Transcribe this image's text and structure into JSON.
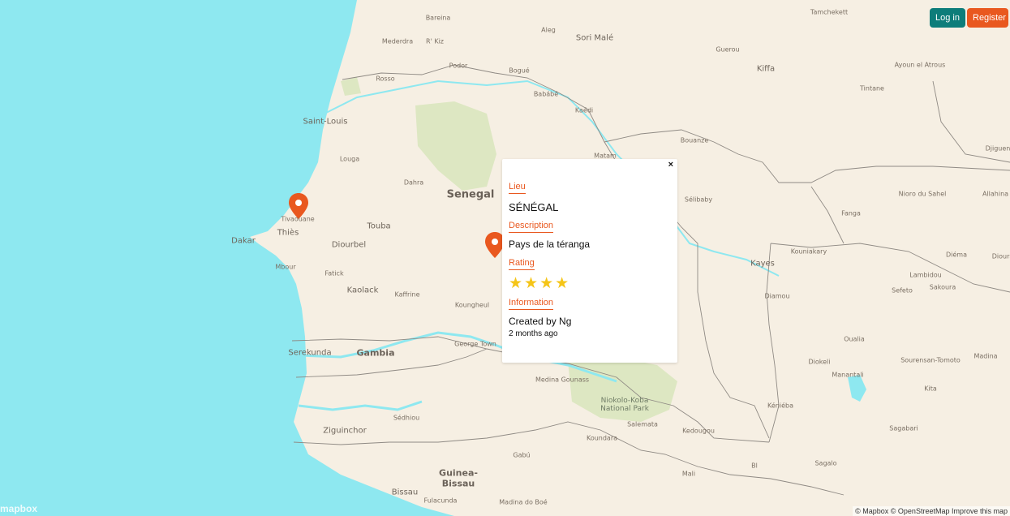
{
  "auth": {
    "login_label": "Log in",
    "register_label": "Register"
  },
  "map": {
    "country_label": "Senegal",
    "gambia_label": "Gambia",
    "guinea_bissau_label": "Guinea-\nBissau",
    "park_label": "Niokolo-Koba\nNational Park",
    "places": [
      "Bareina",
      "Aleg",
      "Sori Malé",
      "Tamchekett",
      "Mederdra",
      "R' Kiz",
      "Guerou",
      "Kiffa",
      "Ayoun el Atrous",
      "Podor",
      "Bogué",
      "Rosso",
      "Babábé",
      "Tintane",
      "Kaédi",
      "Saint-Louis",
      "Bouanze",
      "Djiguen",
      "Louga",
      "Matam",
      "Dahra",
      "Sélibaby",
      "Niorо du Sahel",
      "Allahina",
      "Tivaouane",
      "Fanga",
      "Thiès",
      "Touba",
      "Dakar",
      "Diourbel",
      "Kouniakary",
      "Diéma",
      "Dioura",
      "Mbour",
      "Fatick",
      "Kayes",
      "Lambidou",
      "Kaolack",
      "Kaffrine",
      "Sefeto",
      "Sakoura",
      "Koungheul",
      "Diamou",
      "Oualia",
      "Serekunda",
      "George Town",
      "Diokeli",
      "Sourensan-Tomoto",
      "Madina",
      "Manantali",
      "Medina Gounass",
      "Kita",
      "Kéniéba",
      "Sédhiou",
      "Salemata",
      "Kedougou",
      "Ziguinchor",
      "Koundara",
      "Sagabari",
      "Gabú",
      "Sagalo",
      "Mali",
      "Bissau",
      "Fulacunda",
      "Madina do Boé",
      "Bl"
    ]
  },
  "popup": {
    "close_label": "×",
    "lieu_label": "Lieu",
    "lieu_value": "SÉNÉGAL",
    "description_label": "Description",
    "description_value": "Pays de la téranga",
    "rating_label": "Rating",
    "rating_value": 4,
    "rating_stars": "★★★★",
    "information_label": "Information",
    "created_by": "Created by Ng",
    "created_ago": "2 months ago"
  },
  "footer": {
    "logo_text": "mapbox",
    "attribution": "© Mapbox © OpenStreetMap Improve this map"
  },
  "colors": {
    "water": "#8ee8f0",
    "land": "#f6efe3",
    "park": "#dde7c2",
    "marker": "#e9581f",
    "accent_teal": "#0d7d7a"
  }
}
